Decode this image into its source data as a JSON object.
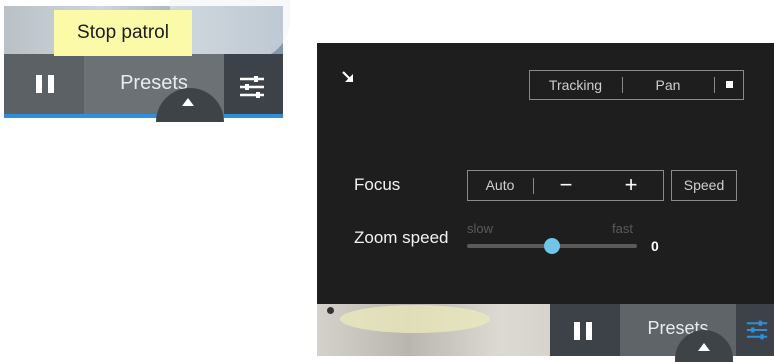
{
  "left_widget": {
    "tooltip": "Stop patrol",
    "presets_label": "Presets",
    "icons": [
      "pause-icon",
      "settings-sliders-icon",
      "chevron-up-icon"
    ]
  },
  "control_panel": {
    "top_buttons": {
      "tracking": "Tracking",
      "pan": "Pan"
    },
    "focus": {
      "label": "Focus",
      "auto": "Auto",
      "minus": "−",
      "plus": "+",
      "speed": "Speed"
    },
    "zoom_speed": {
      "label": "Zoom speed",
      "slow": "slow",
      "fast": "fast",
      "value": "0",
      "slider_position": 0.5
    },
    "icons": [
      "collapse-arrow-icon",
      "stop-icon"
    ]
  },
  "right_widget": {
    "presets_label": "Presets",
    "icons": [
      "pause-icon",
      "settings-sliders-icon",
      "chevron-up-icon"
    ],
    "settings_icon_color": "#2f8fd8"
  },
  "colors": {
    "tooltip_bg": "#fafaa8",
    "panel_bg": "#1e1e1e",
    "slider_knob": "#6fc6e6",
    "accent": "#2f8fd8"
  }
}
